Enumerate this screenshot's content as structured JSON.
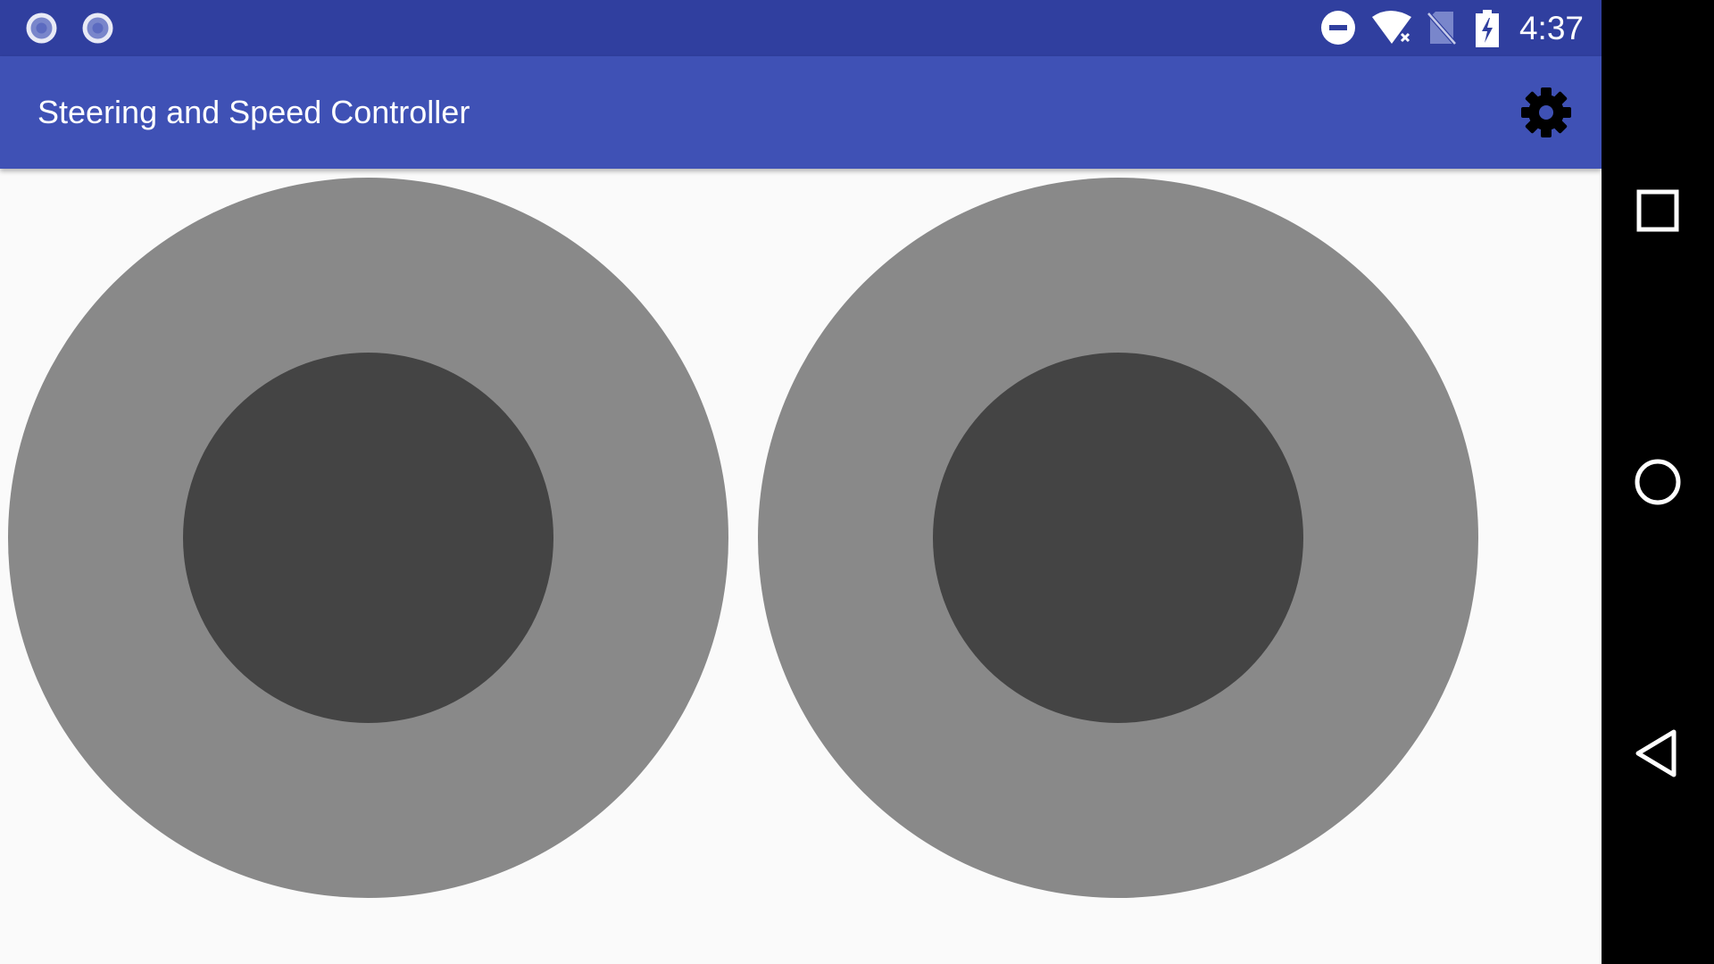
{
  "status_bar": {
    "time": "4:37",
    "left_icons": [
      "record-circle-icon",
      "record-circle-icon"
    ],
    "right_icons": [
      "do-not-disturb-icon",
      "wifi-no-internet-icon",
      "no-sim-icon",
      "battery-charging-icon"
    ]
  },
  "app_bar": {
    "title": "Steering and Speed Controller",
    "settings_icon": "gear-icon"
  },
  "joysticks": [
    {
      "name": "steering-joystick"
    },
    {
      "name": "speed-joystick"
    }
  ],
  "nav_bar": {
    "buttons": [
      "recent-apps-icon",
      "home-icon",
      "back-icon"
    ]
  },
  "colors": {
    "status_bar": "#303f9f",
    "app_bar": "#3f51b5",
    "background": "#fafafa",
    "joystick_base": "#898989",
    "joystick_knob": "#444444"
  }
}
